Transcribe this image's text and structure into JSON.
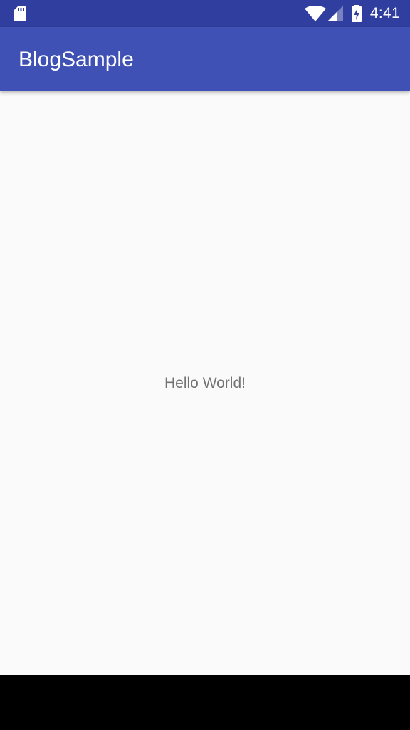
{
  "status_bar": {
    "time": "4:41",
    "icons": [
      "sd-card-icon",
      "wifi-icon",
      "cell-signal-icon",
      "battery-charging-icon"
    ],
    "background_color": "#303f9f"
  },
  "app_bar": {
    "title": "BlogSample",
    "background_color": "#3f51b5"
  },
  "main": {
    "text": "Hello World!"
  },
  "navigation_bar": {
    "background_color": "#000000"
  }
}
